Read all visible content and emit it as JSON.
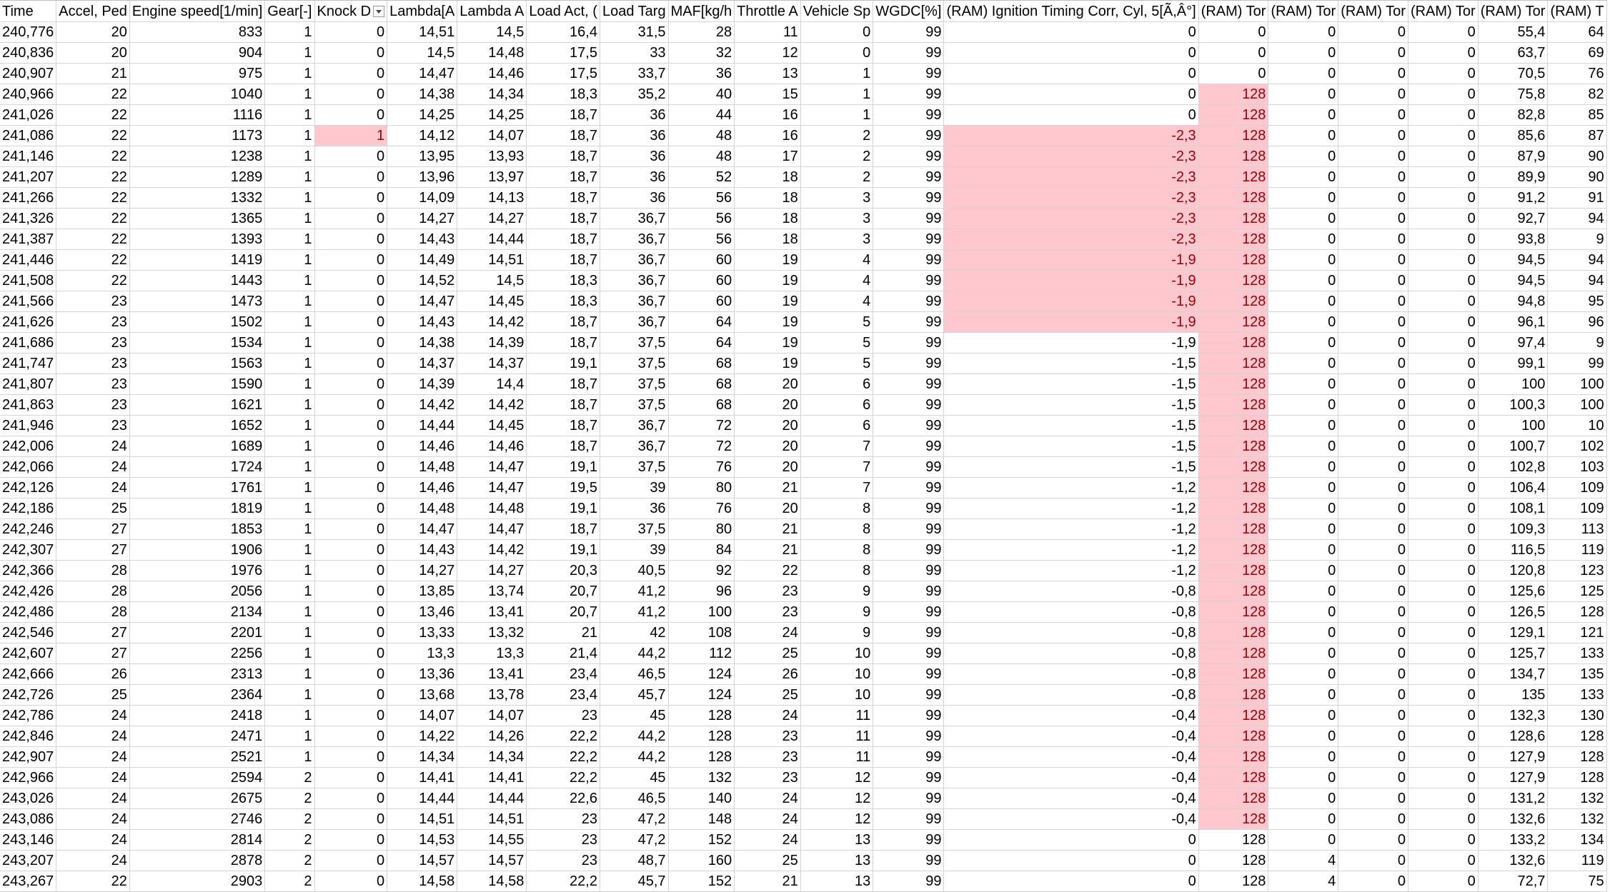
{
  "sheet": {
    "column_letters": [
      "A",
      "B",
      "C",
      "D",
      "E",
      "F",
      "G",
      "H",
      "I",
      "J",
      "K",
      "L",
      "M",
      "N",
      "O",
      "P",
      "Q",
      "R",
      "S",
      "T"
    ],
    "headers": [
      "Time",
      "Accel, Ped",
      "Engine speed[1/min]",
      "Gear[-]",
      "Knock D",
      "Lambda[A",
      "Lambda A",
      "Load Act, (",
      "Load Targ",
      "MAF[kg/h",
      "Throttle A",
      "Vehicle Sp",
      "WGDC[%]",
      "(RAM) Ignition Timing Corr, Cyl, 5[Ã,Â°]",
      "(RAM) Tor",
      "(RAM) Tor",
      "(RAM) Tor",
      "(RAM) Tor",
      "(RAM) Tor",
      "(RAM) T"
    ],
    "rows": [
      [
        "240,776",
        "20",
        "833",
        "1",
        "0",
        "14,51",
        "14,5",
        "16,4",
        "31,5",
        "28",
        "11",
        "0",
        "99",
        "0",
        "0",
        "0",
        "0",
        "0",
        "55,4",
        "64"
      ],
      [
        "240,836",
        "20",
        "904",
        "1",
        "0",
        "14,5",
        "14,48",
        "17,5",
        "33",
        "32",
        "12",
        "0",
        "99",
        "0",
        "0",
        "0",
        "0",
        "0",
        "63,7",
        "69"
      ],
      [
        "240,907",
        "21",
        "975",
        "1",
        "0",
        "14,47",
        "14,46",
        "17,5",
        "33,7",
        "36",
        "13",
        "1",
        "99",
        "0",
        "0",
        "0",
        "0",
        "0",
        "70,5",
        "76"
      ],
      [
        "240,966",
        "22",
        "1040",
        "1",
        "0",
        "14,38",
        "14,34",
        "18,3",
        "35,2",
        "40",
        "15",
        "1",
        "99",
        "0",
        "128",
        "0",
        "0",
        "0",
        "75,8",
        "82"
      ],
      [
        "241,026",
        "22",
        "1116",
        "1",
        "0",
        "14,25",
        "14,25",
        "18,7",
        "36",
        "44",
        "16",
        "1",
        "99",
        "0",
        "128",
        "0",
        "0",
        "0",
        "82,8",
        "85"
      ],
      [
        "241,086",
        "22",
        "1173",
        "1",
        "1",
        "14,12",
        "14,07",
        "18,7",
        "36",
        "48",
        "16",
        "2",
        "99",
        "-2,3",
        "128",
        "0",
        "0",
        "0",
        "85,6",
        "87"
      ],
      [
        "241,146",
        "22",
        "1238",
        "1",
        "0",
        "13,95",
        "13,93",
        "18,7",
        "36",
        "48",
        "17",
        "2",
        "99",
        "-2,3",
        "128",
        "0",
        "0",
        "0",
        "87,9",
        "90"
      ],
      [
        "241,207",
        "22",
        "1289",
        "1",
        "0",
        "13,96",
        "13,97",
        "18,7",
        "36",
        "52",
        "18",
        "2",
        "99",
        "-2,3",
        "128",
        "0",
        "0",
        "0",
        "89,9",
        "90"
      ],
      [
        "241,266",
        "22",
        "1332",
        "1",
        "0",
        "14,09",
        "14,13",
        "18,7",
        "36",
        "56",
        "18",
        "3",
        "99",
        "-2,3",
        "128",
        "0",
        "0",
        "0",
        "91,2",
        "91"
      ],
      [
        "241,326",
        "22",
        "1365",
        "1",
        "0",
        "14,27",
        "14,27",
        "18,7",
        "36,7",
        "56",
        "18",
        "3",
        "99",
        "-2,3",
        "128",
        "0",
        "0",
        "0",
        "92,7",
        "94"
      ],
      [
        "241,387",
        "22",
        "1393",
        "1",
        "0",
        "14,43",
        "14,44",
        "18,7",
        "36,7",
        "56",
        "18",
        "3",
        "99",
        "-2,3",
        "128",
        "0",
        "0",
        "0",
        "93,8",
        "9"
      ],
      [
        "241,446",
        "22",
        "1419",
        "1",
        "0",
        "14,49",
        "14,51",
        "18,7",
        "36,7",
        "60",
        "19",
        "4",
        "99",
        "-1,9",
        "128",
        "0",
        "0",
        "0",
        "94,5",
        "94"
      ],
      [
        "241,508",
        "22",
        "1443",
        "1",
        "0",
        "14,52",
        "14,5",
        "18,3",
        "36,7",
        "60",
        "19",
        "4",
        "99",
        "-1,9",
        "128",
        "0",
        "0",
        "0",
        "94,5",
        "94"
      ],
      [
        "241,566",
        "23",
        "1473",
        "1",
        "0",
        "14,47",
        "14,45",
        "18,3",
        "36,7",
        "60",
        "19",
        "4",
        "99",
        "-1,9",
        "128",
        "0",
        "0",
        "0",
        "94,8",
        "95"
      ],
      [
        "241,626",
        "23",
        "1502",
        "1",
        "0",
        "14,43",
        "14,42",
        "18,7",
        "36,7",
        "64",
        "19",
        "5",
        "99",
        "-1,9",
        "128",
        "0",
        "0",
        "0",
        "96,1",
        "96"
      ],
      [
        "241,686",
        "23",
        "1534",
        "1",
        "0",
        "14,38",
        "14,39",
        "18,7",
        "37,5",
        "64",
        "19",
        "5",
        "99",
        "-1,9",
        "128",
        "0",
        "0",
        "0",
        "97,4",
        "9"
      ],
      [
        "241,747",
        "23",
        "1563",
        "1",
        "0",
        "14,37",
        "14,37",
        "19,1",
        "37,5",
        "68",
        "19",
        "5",
        "99",
        "-1,5",
        "128",
        "0",
        "0",
        "0",
        "99,1",
        "99"
      ],
      [
        "241,807",
        "23",
        "1590",
        "1",
        "0",
        "14,39",
        "14,4",
        "18,7",
        "37,5",
        "68",
        "20",
        "6",
        "99",
        "-1,5",
        "128",
        "0",
        "0",
        "0",
        "100",
        "100"
      ],
      [
        "241,863",
        "23",
        "1621",
        "1",
        "0",
        "14,42",
        "14,42",
        "18,7",
        "37,5",
        "68",
        "20",
        "6",
        "99",
        "-1,5",
        "128",
        "0",
        "0",
        "0",
        "100,3",
        "100"
      ],
      [
        "241,946",
        "23",
        "1652",
        "1",
        "0",
        "14,44",
        "14,45",
        "18,7",
        "36,7",
        "72",
        "20",
        "6",
        "99",
        "-1,5",
        "128",
        "0",
        "0",
        "0",
        "100",
        "10"
      ],
      [
        "242,006",
        "24",
        "1689",
        "1",
        "0",
        "14,46",
        "14,46",
        "18,7",
        "36,7",
        "72",
        "20",
        "7",
        "99",
        "-1,5",
        "128",
        "0",
        "0",
        "0",
        "100,7",
        "102"
      ],
      [
        "242,066",
        "24",
        "1724",
        "1",
        "0",
        "14,48",
        "14,47",
        "19,1",
        "37,5",
        "76",
        "20",
        "7",
        "99",
        "-1,5",
        "128",
        "0",
        "0",
        "0",
        "102,8",
        "103"
      ],
      [
        "242,126",
        "24",
        "1761",
        "1",
        "0",
        "14,46",
        "14,47",
        "19,5",
        "39",
        "80",
        "21",
        "7",
        "99",
        "-1,2",
        "128",
        "0",
        "0",
        "0",
        "106,4",
        "109"
      ],
      [
        "242,186",
        "25",
        "1819",
        "1",
        "0",
        "14,48",
        "14,48",
        "19,1",
        "36",
        "76",
        "20",
        "8",
        "99",
        "-1,2",
        "128",
        "0",
        "0",
        "0",
        "108,1",
        "109"
      ],
      [
        "242,246",
        "27",
        "1853",
        "1",
        "0",
        "14,47",
        "14,47",
        "18,7",
        "37,5",
        "80",
        "21",
        "8",
        "99",
        "-1,2",
        "128",
        "0",
        "0",
        "0",
        "109,3",
        "113"
      ],
      [
        "242,307",
        "27",
        "1906",
        "1",
        "0",
        "14,43",
        "14,42",
        "19,1",
        "39",
        "84",
        "21",
        "8",
        "99",
        "-1,2",
        "128",
        "0",
        "0",
        "0",
        "116,5",
        "119"
      ],
      [
        "242,366",
        "28",
        "1976",
        "1",
        "0",
        "14,27",
        "14,27",
        "20,3",
        "40,5",
        "92",
        "22",
        "8",
        "99",
        "-1,2",
        "128",
        "0",
        "0",
        "0",
        "120,8",
        "123"
      ],
      [
        "242,426",
        "28",
        "2056",
        "1",
        "0",
        "13,85",
        "13,74",
        "20,7",
        "41,2",
        "96",
        "23",
        "9",
        "99",
        "-0,8",
        "128",
        "0",
        "0",
        "0",
        "125,6",
        "125"
      ],
      [
        "242,486",
        "28",
        "2134",
        "1",
        "0",
        "13,46",
        "13,41",
        "20,7",
        "41,2",
        "100",
        "23",
        "9",
        "99",
        "-0,8",
        "128",
        "0",
        "0",
        "0",
        "126,5",
        "128"
      ],
      [
        "242,546",
        "27",
        "2201",
        "1",
        "0",
        "13,33",
        "13,32",
        "21",
        "42",
        "108",
        "24",
        "9",
        "99",
        "-0,8",
        "128",
        "0",
        "0",
        "0",
        "129,1",
        "121"
      ],
      [
        "242,607",
        "27",
        "2256",
        "1",
        "0",
        "13,3",
        "13,3",
        "21,4",
        "44,2",
        "112",
        "25",
        "10",
        "99",
        "-0,8",
        "128",
        "0",
        "0",
        "0",
        "125,7",
        "133"
      ],
      [
        "242,666",
        "26",
        "2313",
        "1",
        "0",
        "13,36",
        "13,41",
        "23,4",
        "46,5",
        "124",
        "26",
        "10",
        "99",
        "-0,8",
        "128",
        "0",
        "0",
        "0",
        "134,7",
        "135"
      ],
      [
        "242,726",
        "25",
        "2364",
        "1",
        "0",
        "13,68",
        "13,78",
        "23,4",
        "45,7",
        "124",
        "25",
        "10",
        "99",
        "-0,8",
        "128",
        "0",
        "0",
        "0",
        "135",
        "133"
      ],
      [
        "242,786",
        "24",
        "2418",
        "1",
        "0",
        "14,07",
        "14,07",
        "23",
        "45",
        "128",
        "24",
        "11",
        "99",
        "-0,4",
        "128",
        "0",
        "0",
        "0",
        "132,3",
        "130"
      ],
      [
        "242,846",
        "24",
        "2471",
        "1",
        "0",
        "14,22",
        "14,26",
        "22,2",
        "44,2",
        "128",
        "23",
        "11",
        "99",
        "-0,4",
        "128",
        "0",
        "0",
        "0",
        "128,6",
        "128"
      ],
      [
        "242,907",
        "24",
        "2521",
        "1",
        "0",
        "14,34",
        "14,34",
        "22,2",
        "44,2",
        "128",
        "23",
        "11",
        "99",
        "-0,4",
        "128",
        "0",
        "0",
        "0",
        "127,9",
        "128"
      ],
      [
        "242,966",
        "24",
        "2594",
        "2",
        "0",
        "14,41",
        "14,41",
        "22,2",
        "45",
        "132",
        "23",
        "12",
        "99",
        "-0,4",
        "128",
        "0",
        "0",
        "0",
        "127,9",
        "128"
      ],
      [
        "243,026",
        "24",
        "2675",
        "2",
        "0",
        "14,44",
        "14,44",
        "22,6",
        "46,5",
        "140",
        "24",
        "12",
        "99",
        "-0,4",
        "128",
        "0",
        "0",
        "0",
        "131,2",
        "132"
      ],
      [
        "243,086",
        "24",
        "2746",
        "2",
        "0",
        "14,51",
        "14,51",
        "23",
        "47,2",
        "148",
        "24",
        "12",
        "99",
        "-0,4",
        "128",
        "0",
        "0",
        "0",
        "132,6",
        "132"
      ],
      [
        "243,146",
        "24",
        "2814",
        "2",
        "0",
        "14,53",
        "14,55",
        "23",
        "47,2",
        "152",
        "24",
        "13",
        "99",
        "0",
        "128",
        "0",
        "0",
        "0",
        "133,2",
        "134"
      ],
      [
        "243,207",
        "24",
        "2878",
        "2",
        "0",
        "14,57",
        "14,57",
        "23",
        "48,7",
        "160",
        "25",
        "13",
        "99",
        "0",
        "128",
        "4",
        "0",
        "0",
        "132,6",
        "119"
      ],
      [
        "243,267",
        "22",
        "2903",
        "2",
        "0",
        "14,58",
        "14,58",
        "22,2",
        "45,7",
        "152",
        "21",
        "13",
        "99",
        "0",
        "128",
        "4",
        "0",
        "0",
        "72,7",
        "75"
      ]
    ],
    "highlight_color": "#ffc7ce",
    "highlight_text_color": "#9c0006"
  }
}
